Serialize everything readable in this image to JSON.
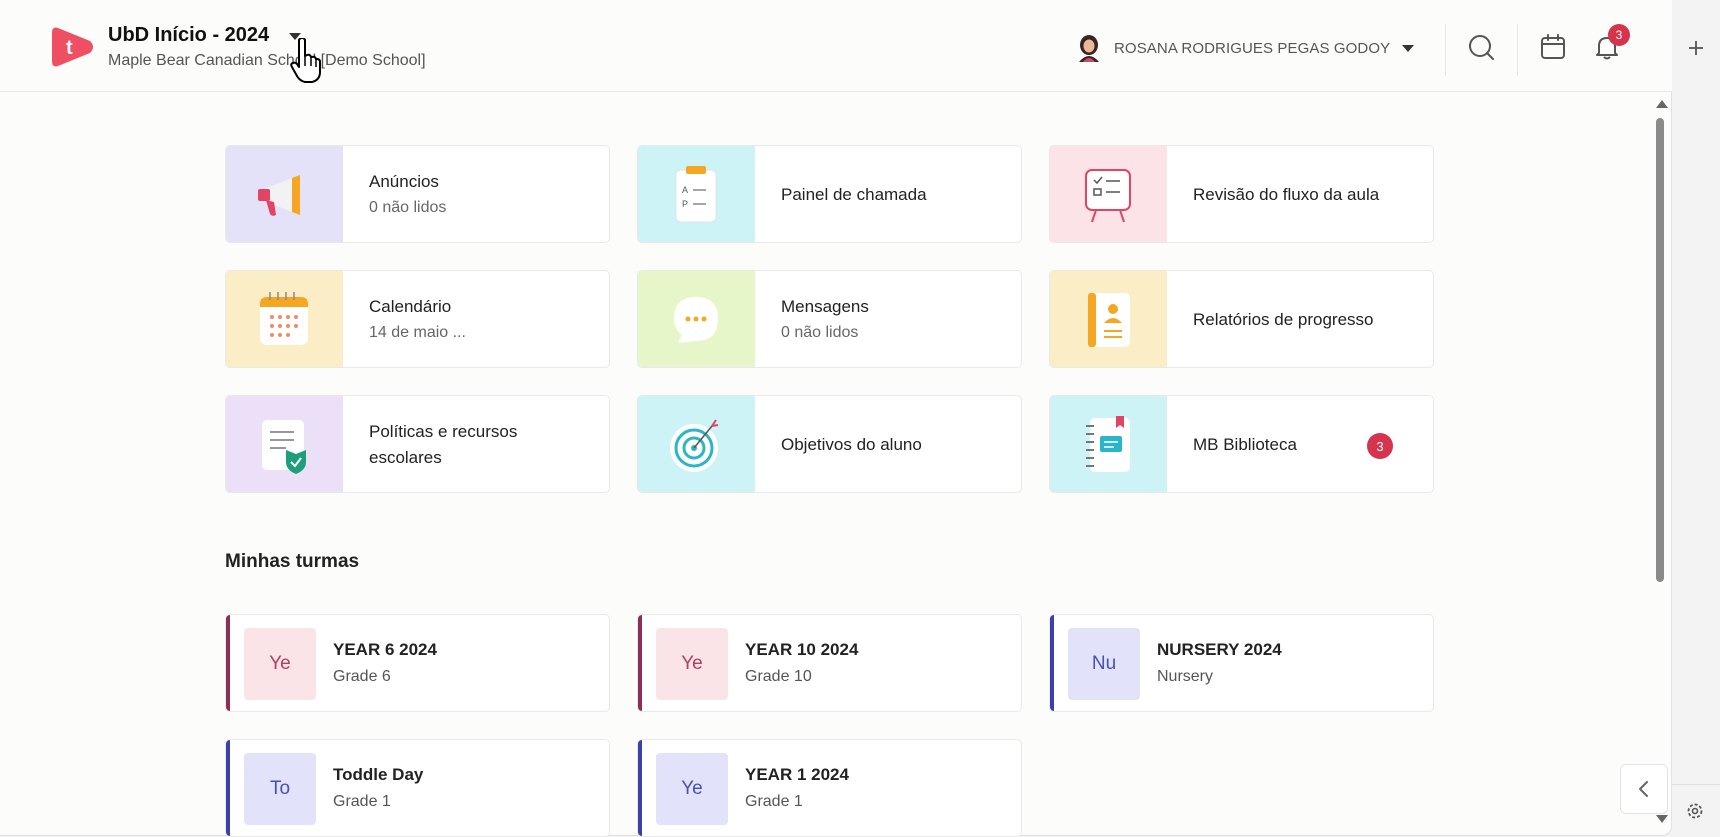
{
  "header": {
    "app_title": "UbD Início - 2024",
    "school_name": "Maple Bear Canadian School [Demo School]",
    "logo_letter": "t",
    "user_name": "ROSANA RODRIGUES PEGAS GODOY",
    "notifications_count": "3",
    "icons": [
      "search-icon",
      "calendar-icon",
      "bell-icon"
    ]
  },
  "tiles": [
    {
      "title": "Anúncios",
      "subtitle": "0 não lidos",
      "icon": "megaphone-icon",
      "bg": "#e4e2f8"
    },
    {
      "title": "Painel de chamada",
      "subtitle": "",
      "icon": "attendance-clipboard-icon",
      "bg": "#cdf3f7"
    },
    {
      "title": "Revisão do fluxo da aula",
      "subtitle": "",
      "icon": "lesson-board-icon",
      "bg": "#fbe3e8"
    },
    {
      "title": "Calendário",
      "subtitle": "14 de maio ...",
      "icon": "calendar-icon",
      "bg": "#fbeec6"
    },
    {
      "title": "Mensagens",
      "subtitle": "0 não lidos",
      "icon": "chat-bubble-icon",
      "bg": "#e6f6c9"
    },
    {
      "title": "Relatórios de progresso",
      "subtitle": "",
      "icon": "report-book-icon",
      "bg": "#fbeec6"
    },
    {
      "title": "Políticas e recursos escolares",
      "subtitle": "",
      "icon": "policy-document-icon",
      "bg": "#ecdff8"
    },
    {
      "title": "Objetivos do aluno",
      "subtitle": "",
      "icon": "target-icon",
      "bg": "#cdf3f7"
    },
    {
      "title": "MB Biblioteca",
      "subtitle": "",
      "icon": "notebook-icon",
      "bg": "#cdf3f7",
      "badge": "3"
    }
  ],
  "classes_section": {
    "title": "Minhas turmas",
    "items": [
      {
        "abbr": "Ye",
        "name": "YEAR 6 2024",
        "grade": "Grade 6",
        "bar": "#8c2f56",
        "tile_bg": "#fbe4e8",
        "tile_fg": "#b0405f"
      },
      {
        "abbr": "Ye",
        "name": "YEAR 10 2024",
        "grade": "Grade 10",
        "bar": "#8c2f56",
        "tile_bg": "#fbe4e8",
        "tile_fg": "#b0405f"
      },
      {
        "abbr": "Nu",
        "name": "NURSERY 2024",
        "grade": "Nursery",
        "bar": "#3c41a8",
        "tile_bg": "#e2e3fa",
        "tile_fg": "#4a4fb5"
      },
      {
        "abbr": "To",
        "name": "Toddle Day",
        "grade": "Grade 1",
        "bar": "#3c41a8",
        "tile_bg": "#e2e3fa",
        "tile_fg": "#4a4fb5"
      },
      {
        "abbr": "Ye",
        "name": "YEAR 1 2024",
        "grade": "Grade 1",
        "bar": "#3c41a8",
        "tile_bg": "#e2e3fa",
        "tile_fg": "#4a4fb5"
      }
    ]
  },
  "colors": {
    "brand": "#ef4f62",
    "badge": "#d6334d"
  }
}
